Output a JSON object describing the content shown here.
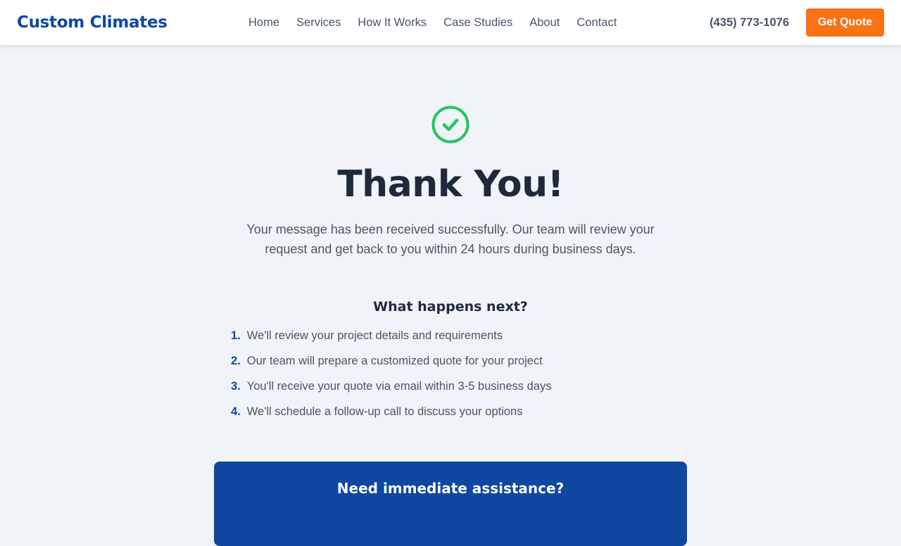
{
  "header": {
    "logo": "Custom Climates",
    "nav": [
      "Home",
      "Services",
      "How It Works",
      "Case Studies",
      "About",
      "Contact"
    ],
    "phone": "(435) 773-1076",
    "cta": "Get Quote"
  },
  "main": {
    "icon": "check-circle-icon",
    "title": "Thank You!",
    "message": "Your message has been received successfully. Our team will review your request and get back to you within 24 hours during business days.",
    "next_title": "What happens next?",
    "steps": [
      {
        "num": "1.",
        "text": "We'll review your project details and requirements"
      },
      {
        "num": "2.",
        "text": "Our team will prepare a customized quote for your project"
      },
      {
        "num": "3.",
        "text": "You'll receive your quote via email within 3-5 business days"
      },
      {
        "num": "4.",
        "text": "We'll schedule a follow-up call to discuss your options"
      }
    ],
    "assist_title": "Need immediate assistance?"
  },
  "colors": {
    "brand": "#0f47a1",
    "accent": "#f97316",
    "success": "#22c55e",
    "background": "#f0f4f8"
  }
}
